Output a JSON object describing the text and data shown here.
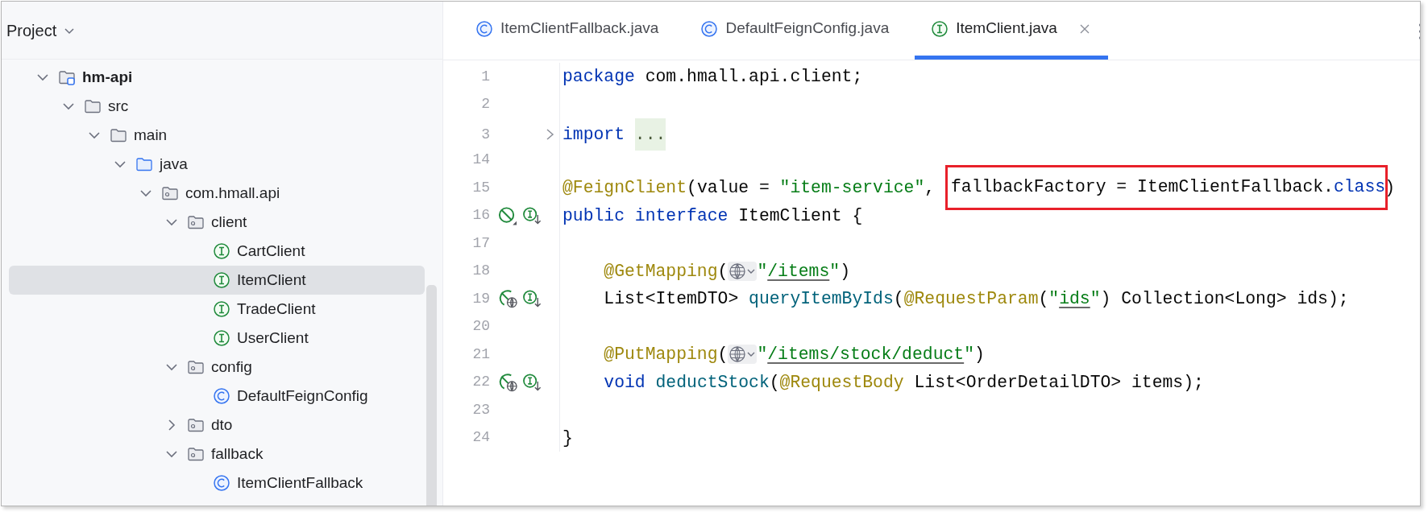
{
  "project_panel": {
    "title": "Project",
    "tree": [
      {
        "label": "hm-api",
        "kind": "module",
        "expanded": true,
        "selected": false,
        "children": [
          {
            "label": "src",
            "kind": "folder",
            "expanded": true,
            "selected": false,
            "children": [
              {
                "label": "main",
                "kind": "folder",
                "expanded": true,
                "selected": false,
                "children": [
                  {
                    "label": "java",
                    "kind": "source-folder",
                    "expanded": true,
                    "selected": false,
                    "children": [
                      {
                        "label": "com.hmall.api",
                        "kind": "package",
                        "expanded": true,
                        "selected": false,
                        "children": [
                          {
                            "label": "client",
                            "kind": "package",
                            "expanded": true,
                            "selected": false,
                            "children": [
                              {
                                "label": "CartClient",
                                "kind": "interface",
                                "selected": false
                              },
                              {
                                "label": "ItemClient",
                                "kind": "interface",
                                "selected": true
                              },
                              {
                                "label": "TradeClient",
                                "kind": "interface",
                                "selected": false
                              },
                              {
                                "label": "UserClient",
                                "kind": "interface",
                                "selected": false
                              }
                            ]
                          },
                          {
                            "label": "config",
                            "kind": "package",
                            "expanded": true,
                            "selected": false,
                            "children": [
                              {
                                "label": "DefaultFeignConfig",
                                "kind": "class",
                                "selected": false
                              }
                            ]
                          },
                          {
                            "label": "dto",
                            "kind": "package",
                            "expanded": false,
                            "selected": false
                          },
                          {
                            "label": "fallback",
                            "kind": "package",
                            "expanded": true,
                            "selected": false,
                            "children": [
                              {
                                "label": "ItemClientFallback",
                                "kind": "class",
                                "selected": false
                              }
                            ]
                          }
                        ]
                      }
                    ]
                  }
                ]
              }
            ]
          }
        ]
      }
    ]
  },
  "editor": {
    "tabs": [
      {
        "label": "ItemClientFallback.java",
        "kind": "class",
        "selected": false,
        "closable": false
      },
      {
        "label": "DefaultFeignConfig.java",
        "kind": "class",
        "selected": false,
        "closable": false
      },
      {
        "label": "ItemClient.java",
        "kind": "interface",
        "selected": true,
        "closable": true
      }
    ],
    "lines": [
      {
        "number": "1",
        "tokens": [
          {
            "kind": "keyword",
            "text": "package"
          },
          {
            "kind": "plain",
            "text": " com.hmall.api.client;"
          }
        ]
      },
      {
        "number": "2"
      },
      {
        "number": "3",
        "foldable": true,
        "tokens": [
          {
            "kind": "keyword",
            "text": "import "
          },
          {
            "kind": "folded",
            "text": "..."
          }
        ]
      },
      {
        "number": "14"
      },
      {
        "number": "15",
        "tokens": [
          {
            "kind": "annotation",
            "text": "@FeignClient"
          },
          {
            "kind": "plain",
            "text": "(value = "
          },
          {
            "kind": "string",
            "text": "\"item-service\""
          },
          {
            "kind": "plain",
            "text": ", "
          },
          {
            "kind": "box",
            "tokens": [
              {
                "kind": "plain",
                "text": "fallbackFactory = ItemClientFallback."
              },
              {
                "kind": "keyword",
                "text": "class"
              }
            ]
          },
          {
            "kind": "plain",
            "text": ")"
          }
        ]
      },
      {
        "number": "16",
        "gutter": [
          {
            "kind": "crossed-circle"
          },
          {
            "kind": "interface-down"
          }
        ],
        "tokens": [
          {
            "kind": "keyword",
            "text": "public "
          },
          {
            "kind": "keyword",
            "text": "interface"
          },
          {
            "kind": "plain",
            "text": " ItemClient {"
          }
        ]
      },
      {
        "number": "17"
      },
      {
        "number": "18",
        "tokens": [
          {
            "kind": "annotation",
            "text": "    @GetMapping"
          },
          {
            "kind": "plain",
            "text": "("
          },
          {
            "kind": "inlay"
          },
          {
            "kind": "string",
            "text": "\""
          },
          {
            "kind": "link",
            "text": "/items"
          },
          {
            "kind": "string",
            "text": "\""
          },
          {
            "kind": "plain",
            "text": ")"
          }
        ]
      },
      {
        "number": "19",
        "gutter": [
          {
            "kind": "web-endpoint"
          },
          {
            "kind": "interface-down"
          }
        ],
        "tokens": [
          {
            "kind": "plain",
            "text": "    List<ItemDTO> "
          },
          {
            "kind": "method",
            "text": "queryItemByIds"
          },
          {
            "kind": "plain",
            "text": "("
          },
          {
            "kind": "annotation",
            "text": "@RequestParam"
          },
          {
            "kind": "plain",
            "text": "("
          },
          {
            "kind": "string",
            "text": "\""
          },
          {
            "kind": "link",
            "text": "ids"
          },
          {
            "kind": "string",
            "text": "\""
          },
          {
            "kind": "plain",
            "text": ") Collection<Long> ids);"
          }
        ]
      },
      {
        "number": "20"
      },
      {
        "number": "21",
        "tokens": [
          {
            "kind": "annotation",
            "text": "    @PutMapping"
          },
          {
            "kind": "plain",
            "text": "("
          },
          {
            "kind": "inlay"
          },
          {
            "kind": "string",
            "text": "\""
          },
          {
            "kind": "link",
            "text": "/items/stock/deduct"
          },
          {
            "kind": "string",
            "text": "\""
          },
          {
            "kind": "plain",
            "text": ")"
          }
        ]
      },
      {
        "number": "22",
        "gutter": [
          {
            "kind": "web-endpoint"
          },
          {
            "kind": "interface-down"
          }
        ],
        "tokens": [
          {
            "kind": "keyword",
            "text": "    void "
          },
          {
            "kind": "method",
            "text": "deductStock"
          },
          {
            "kind": "plain",
            "text": "("
          },
          {
            "kind": "annotation",
            "text": "@RequestBody"
          },
          {
            "kind": "plain",
            "text": " List<OrderDetailDTO> items);"
          }
        ]
      },
      {
        "number": "23"
      },
      {
        "number": "24",
        "tokens": [
          {
            "kind": "plain",
            "text": "}"
          }
        ]
      }
    ]
  }
}
